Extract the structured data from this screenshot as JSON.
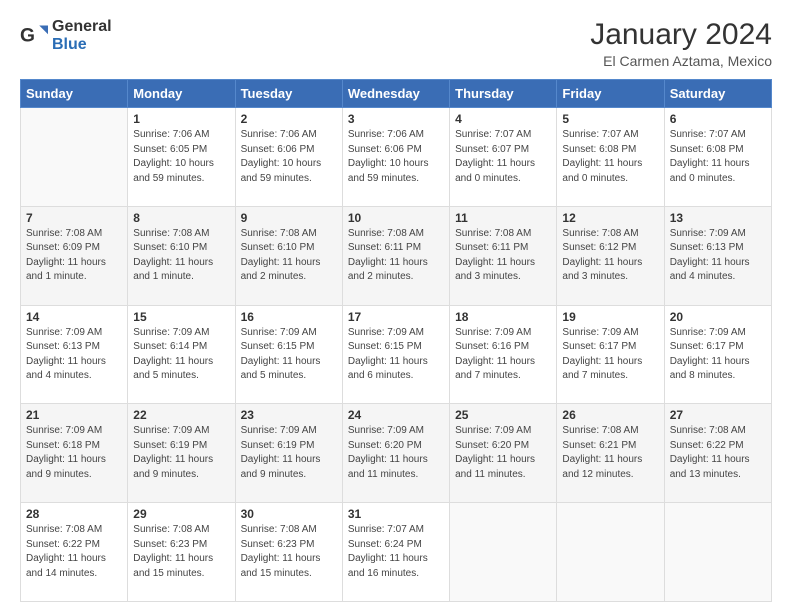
{
  "header": {
    "logo_general": "General",
    "logo_blue": "Blue",
    "title": "January 2024",
    "subtitle": "El Carmen Aztama, Mexico"
  },
  "calendar": {
    "headers": [
      "Sunday",
      "Monday",
      "Tuesday",
      "Wednesday",
      "Thursday",
      "Friday",
      "Saturday"
    ],
    "weeks": [
      [
        {
          "day": "",
          "info": ""
        },
        {
          "day": "1",
          "info": "Sunrise: 7:06 AM\nSunset: 6:05 PM\nDaylight: 10 hours\nand 59 minutes."
        },
        {
          "day": "2",
          "info": "Sunrise: 7:06 AM\nSunset: 6:06 PM\nDaylight: 10 hours\nand 59 minutes."
        },
        {
          "day": "3",
          "info": "Sunrise: 7:06 AM\nSunset: 6:06 PM\nDaylight: 10 hours\nand 59 minutes."
        },
        {
          "day": "4",
          "info": "Sunrise: 7:07 AM\nSunset: 6:07 PM\nDaylight: 11 hours\nand 0 minutes."
        },
        {
          "day": "5",
          "info": "Sunrise: 7:07 AM\nSunset: 6:08 PM\nDaylight: 11 hours\nand 0 minutes."
        },
        {
          "day": "6",
          "info": "Sunrise: 7:07 AM\nSunset: 6:08 PM\nDaylight: 11 hours\nand 0 minutes."
        }
      ],
      [
        {
          "day": "7",
          "info": "Sunrise: 7:08 AM\nSunset: 6:09 PM\nDaylight: 11 hours\nand 1 minute."
        },
        {
          "day": "8",
          "info": "Sunrise: 7:08 AM\nSunset: 6:10 PM\nDaylight: 11 hours\nand 1 minute."
        },
        {
          "day": "9",
          "info": "Sunrise: 7:08 AM\nSunset: 6:10 PM\nDaylight: 11 hours\nand 2 minutes."
        },
        {
          "day": "10",
          "info": "Sunrise: 7:08 AM\nSunset: 6:11 PM\nDaylight: 11 hours\nand 2 minutes."
        },
        {
          "day": "11",
          "info": "Sunrise: 7:08 AM\nSunset: 6:11 PM\nDaylight: 11 hours\nand 3 minutes."
        },
        {
          "day": "12",
          "info": "Sunrise: 7:08 AM\nSunset: 6:12 PM\nDaylight: 11 hours\nand 3 minutes."
        },
        {
          "day": "13",
          "info": "Sunrise: 7:09 AM\nSunset: 6:13 PM\nDaylight: 11 hours\nand 4 minutes."
        }
      ],
      [
        {
          "day": "14",
          "info": "Sunrise: 7:09 AM\nSunset: 6:13 PM\nDaylight: 11 hours\nand 4 minutes."
        },
        {
          "day": "15",
          "info": "Sunrise: 7:09 AM\nSunset: 6:14 PM\nDaylight: 11 hours\nand 5 minutes."
        },
        {
          "day": "16",
          "info": "Sunrise: 7:09 AM\nSunset: 6:15 PM\nDaylight: 11 hours\nand 5 minutes."
        },
        {
          "day": "17",
          "info": "Sunrise: 7:09 AM\nSunset: 6:15 PM\nDaylight: 11 hours\nand 6 minutes."
        },
        {
          "day": "18",
          "info": "Sunrise: 7:09 AM\nSunset: 6:16 PM\nDaylight: 11 hours\nand 7 minutes."
        },
        {
          "day": "19",
          "info": "Sunrise: 7:09 AM\nSunset: 6:17 PM\nDaylight: 11 hours\nand 7 minutes."
        },
        {
          "day": "20",
          "info": "Sunrise: 7:09 AM\nSunset: 6:17 PM\nDaylight: 11 hours\nand 8 minutes."
        }
      ],
      [
        {
          "day": "21",
          "info": "Sunrise: 7:09 AM\nSunset: 6:18 PM\nDaylight: 11 hours\nand 9 minutes."
        },
        {
          "day": "22",
          "info": "Sunrise: 7:09 AM\nSunset: 6:19 PM\nDaylight: 11 hours\nand 9 minutes."
        },
        {
          "day": "23",
          "info": "Sunrise: 7:09 AM\nSunset: 6:19 PM\nDaylight: 11 hours\nand 9 minutes."
        },
        {
          "day": "24",
          "info": "Sunrise: 7:09 AM\nSunset: 6:20 PM\nDaylight: 11 hours\nand 11 minutes."
        },
        {
          "day": "25",
          "info": "Sunrise: 7:09 AM\nSunset: 6:20 PM\nDaylight: 11 hours\nand 11 minutes."
        },
        {
          "day": "26",
          "info": "Sunrise: 7:08 AM\nSunset: 6:21 PM\nDaylight: 11 hours\nand 12 minutes."
        },
        {
          "day": "27",
          "info": "Sunrise: 7:08 AM\nSunset: 6:22 PM\nDaylight: 11 hours\nand 13 minutes."
        }
      ],
      [
        {
          "day": "28",
          "info": "Sunrise: 7:08 AM\nSunset: 6:22 PM\nDaylight: 11 hours\nand 14 minutes."
        },
        {
          "day": "29",
          "info": "Sunrise: 7:08 AM\nSunset: 6:23 PM\nDaylight: 11 hours\nand 15 minutes."
        },
        {
          "day": "30",
          "info": "Sunrise: 7:08 AM\nSunset: 6:23 PM\nDaylight: 11 hours\nand 15 minutes."
        },
        {
          "day": "31",
          "info": "Sunrise: 7:07 AM\nSunset: 6:24 PM\nDaylight: 11 hours\nand 16 minutes."
        },
        {
          "day": "",
          "info": ""
        },
        {
          "day": "",
          "info": ""
        },
        {
          "day": "",
          "info": ""
        }
      ]
    ]
  }
}
